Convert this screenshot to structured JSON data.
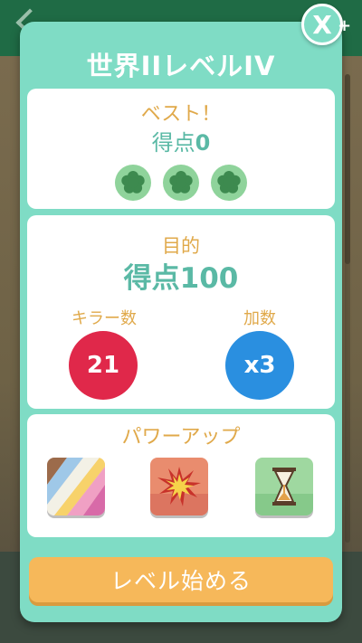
{
  "modal": {
    "title": "世界IIレベルIV",
    "close_label": "X",
    "plus_label": "+"
  },
  "best": {
    "label": "ベスト！",
    "score_prefix": "得点",
    "score_value": "0",
    "stars_earned": 0,
    "stars_total": 3
  },
  "goal": {
    "label": "目的",
    "value": "得点100",
    "killer_label": "キラー数",
    "killer_value": "21",
    "multiplier_label": "加数",
    "multiplier_value": "x3"
  },
  "powerups": {
    "label": "パワーアップ",
    "items": [
      {
        "icon": "rainbow-stripes-icon"
      },
      {
        "icon": "explosion-icon"
      },
      {
        "icon": "hourglass-icon"
      }
    ]
  },
  "start_button": {
    "label": "レベル始める"
  },
  "colors": {
    "panel": "#7fdcc5",
    "orange_text": "#e0a94a",
    "teal_text": "#5ab9a5",
    "killer_red": "#e0284a",
    "multiplier_blue": "#2a8fe0",
    "button": "#f6b85a"
  }
}
